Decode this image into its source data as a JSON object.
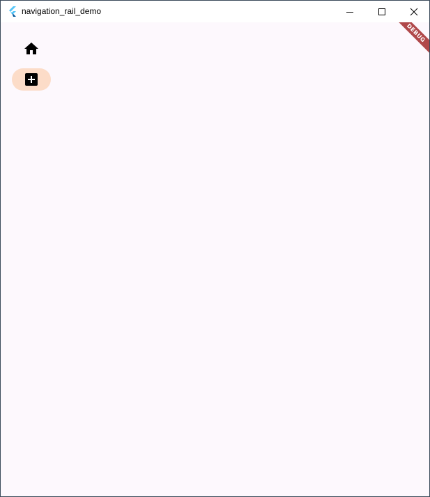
{
  "window": {
    "title": "navigation_rail_demo",
    "controls": {
      "minimize_icon": "minimize-icon",
      "maximize_icon": "maximize-icon",
      "close_icon": "close-icon"
    }
  },
  "rail": {
    "destinations": [
      {
        "icon": "home-icon",
        "selected": false
      },
      {
        "icon": "add-box-icon",
        "selected": true
      }
    ],
    "indicator_color": "#fcdcc8"
  },
  "debug_banner": {
    "label": "DEBUG",
    "color": "#b0484a"
  },
  "colors": {
    "background": "#fdf8fd",
    "titlebar": "#ffffff"
  }
}
